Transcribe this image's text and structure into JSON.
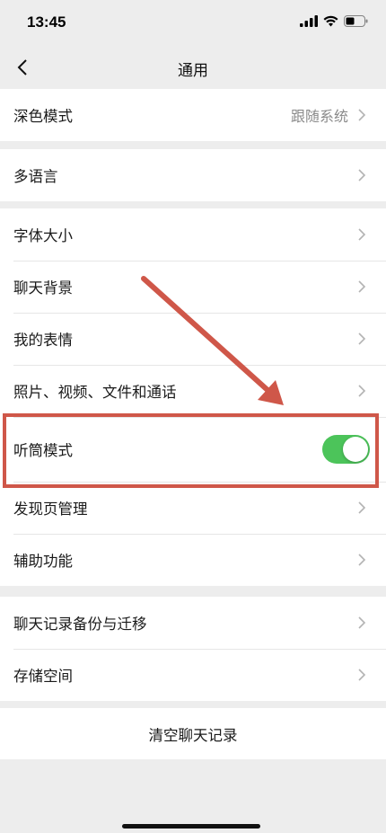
{
  "status_bar": {
    "time": "13:45"
  },
  "nav": {
    "title": "通用",
    "back_icon": "chevron-left-icon"
  },
  "groups": [
    {
      "items": [
        {
          "label": "深色模式",
          "value": "跟随系统"
        }
      ]
    },
    {
      "items": [
        {
          "label": "多语言"
        }
      ]
    },
    {
      "items": [
        {
          "label": "字体大小"
        },
        {
          "label": "聊天背景"
        },
        {
          "label": "我的表情"
        },
        {
          "label": "照片、视频、文件和通话"
        },
        {
          "label": "听筒模式",
          "toggle": true,
          "toggle_state": "on"
        },
        {
          "label": "发现页管理"
        },
        {
          "label": "辅助功能"
        }
      ]
    },
    {
      "items": [
        {
          "label": "聊天记录备份与迁移"
        },
        {
          "label": "存储空间"
        }
      ]
    }
  ],
  "clear_chat": {
    "label": "清空聊天记录"
  },
  "colors": {
    "background": "#ededed",
    "toggle_on": "#4cc45a",
    "annotation": "#cf5749",
    "secondary_text": "#8a8a8a"
  }
}
